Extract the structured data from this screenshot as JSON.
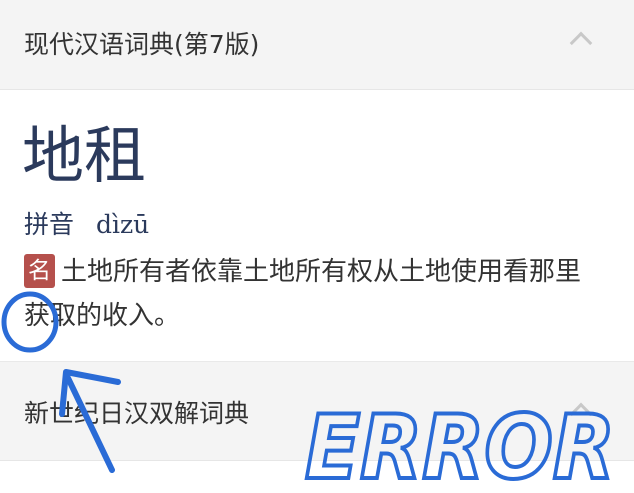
{
  "sections": [
    {
      "title": "现代汉语词典(第7版)",
      "chevron": "chevron-up-icon",
      "expanded": true
    },
    {
      "title": "新世纪日汉双解词典",
      "chevron": "chevron-up-icon",
      "expanded": false
    }
  ],
  "entry": {
    "headword": "地租",
    "pinyin_label": "拼音",
    "pinyin": "dìzū",
    "pos": "名",
    "definition": "土地所有者依靠土地所有权从土地使用看那里获取的收入。"
  },
  "annotation": {
    "text": "ERROR",
    "color": "#2a6bd6"
  },
  "colors": {
    "header_bg": "#f4f4f4",
    "headword": "#2b3a5c",
    "pos_badge": "#b5504c"
  }
}
